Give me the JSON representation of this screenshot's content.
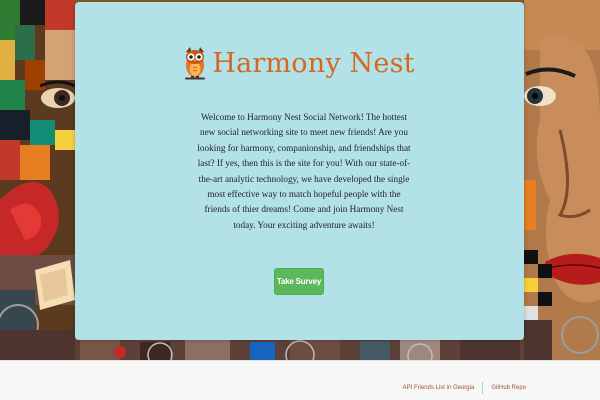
{
  "brand": {
    "title": "Harmony Nest",
    "logo_icon": "owl-icon",
    "title_color": "#d2691e"
  },
  "intro": {
    "text": "Welcome to Harmony Nest Social Network! The hottest new social networking site to meet new friends! Are you looking for harmony, companionship, and friendships that last? If yes, then this is the site for you! With our state-of-the-art analytic technology, we have developed the single most effective way to match hopeful people with the friends of thier dreams! Come and join Harmony Nest today. Your exciting adventure awaits!"
  },
  "survey_button": {
    "label": "Take Survey",
    "color": "#5cb85c"
  },
  "footer": {
    "links": [
      {
        "label": "API Friends List in Georgia"
      },
      {
        "label": "GitHub Repo"
      }
    ],
    "link_color": "#a0522d"
  },
  "colors": {
    "card_background": "#b2e2e8",
    "footer_background": "#f7f7f7"
  }
}
